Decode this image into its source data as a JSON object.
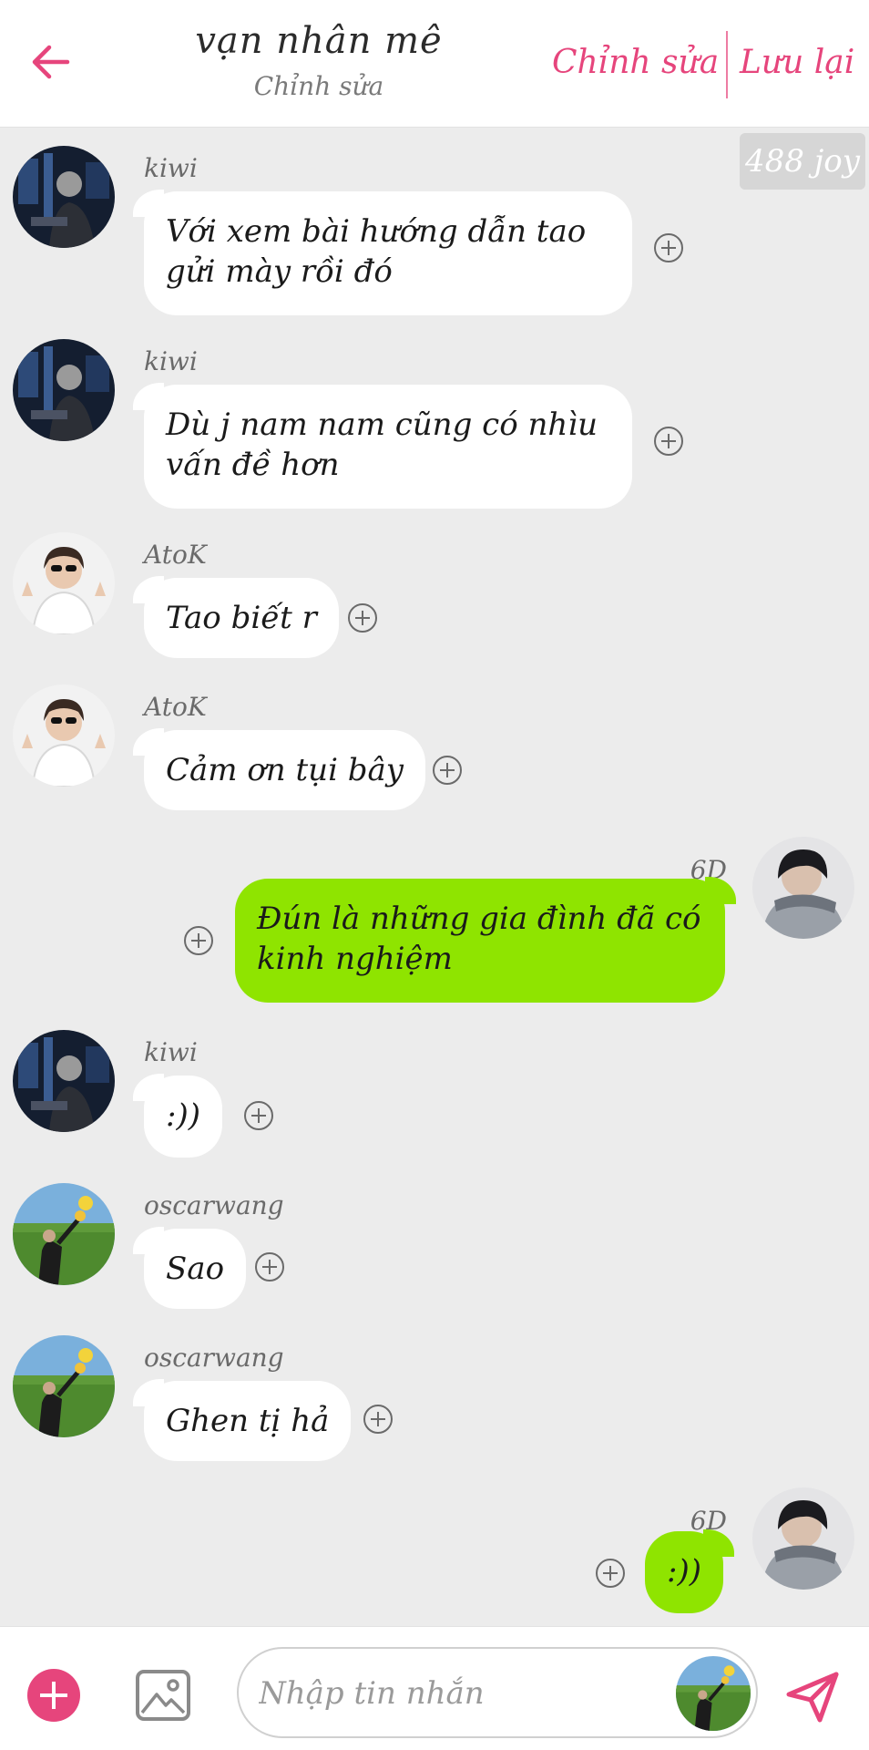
{
  "header": {
    "title": "vạn nhân mê",
    "subtitle": "Chỉnh sửa",
    "edit_label": "Chỉnh sửa",
    "save_label": "Lưu lại"
  },
  "badge": {
    "text": "488 joy"
  },
  "messages": [
    {
      "side": "left",
      "sender": "kiwi",
      "lines": [
        "Với xem bài hướng dẫn tao",
        "gửi mày rồi đó"
      ],
      "avatar": "dark-studio-avatar"
    },
    {
      "side": "left",
      "sender": "kiwi",
      "lines": [
        "Dù j nam nam cũng có nhìu",
        "vấn đề hơn"
      ],
      "avatar": "dark-studio-avatar"
    },
    {
      "side": "left",
      "sender": "AtoK",
      "lines": [
        "Tao biết r"
      ],
      "avatar": "white-hoodie-avatar"
    },
    {
      "side": "left",
      "sender": "AtoK",
      "lines": [
        "Cảm ơn tụi bây"
      ],
      "avatar": "white-hoodie-avatar"
    },
    {
      "side": "right",
      "sender": "6D",
      "lines": [
        "Đún là những gia đình đã có",
        "kinh nghiệm"
      ],
      "avatar": "grey-scarf-avatar"
    },
    {
      "side": "left",
      "sender": "kiwi",
      "lines": [
        ":))"
      ],
      "avatar": "dark-studio-avatar"
    },
    {
      "side": "left",
      "sender": "oscarwang",
      "lines": [
        "Sao"
      ],
      "avatar": "field-avatar"
    },
    {
      "side": "left",
      "sender": "oscarwang",
      "lines": [
        "Ghen tị hả"
      ],
      "avatar": "field-avatar"
    },
    {
      "side": "right",
      "sender": "6D",
      "lines": [
        ":))"
      ],
      "avatar": "grey-scarf-avatar"
    }
  ],
  "composer": {
    "placeholder": "Nhập tin nhắn",
    "value": ""
  },
  "icons": {
    "back": "arrow-left-icon",
    "add": "plus-circle-icon",
    "image": "image-icon",
    "send": "send-icon",
    "react": "plus-circle-outline-icon"
  },
  "colors": {
    "accent": "#e6457c",
    "own_bubble": "#8fe400",
    "other_bubble": "#ffffff",
    "background": "#ececec"
  }
}
